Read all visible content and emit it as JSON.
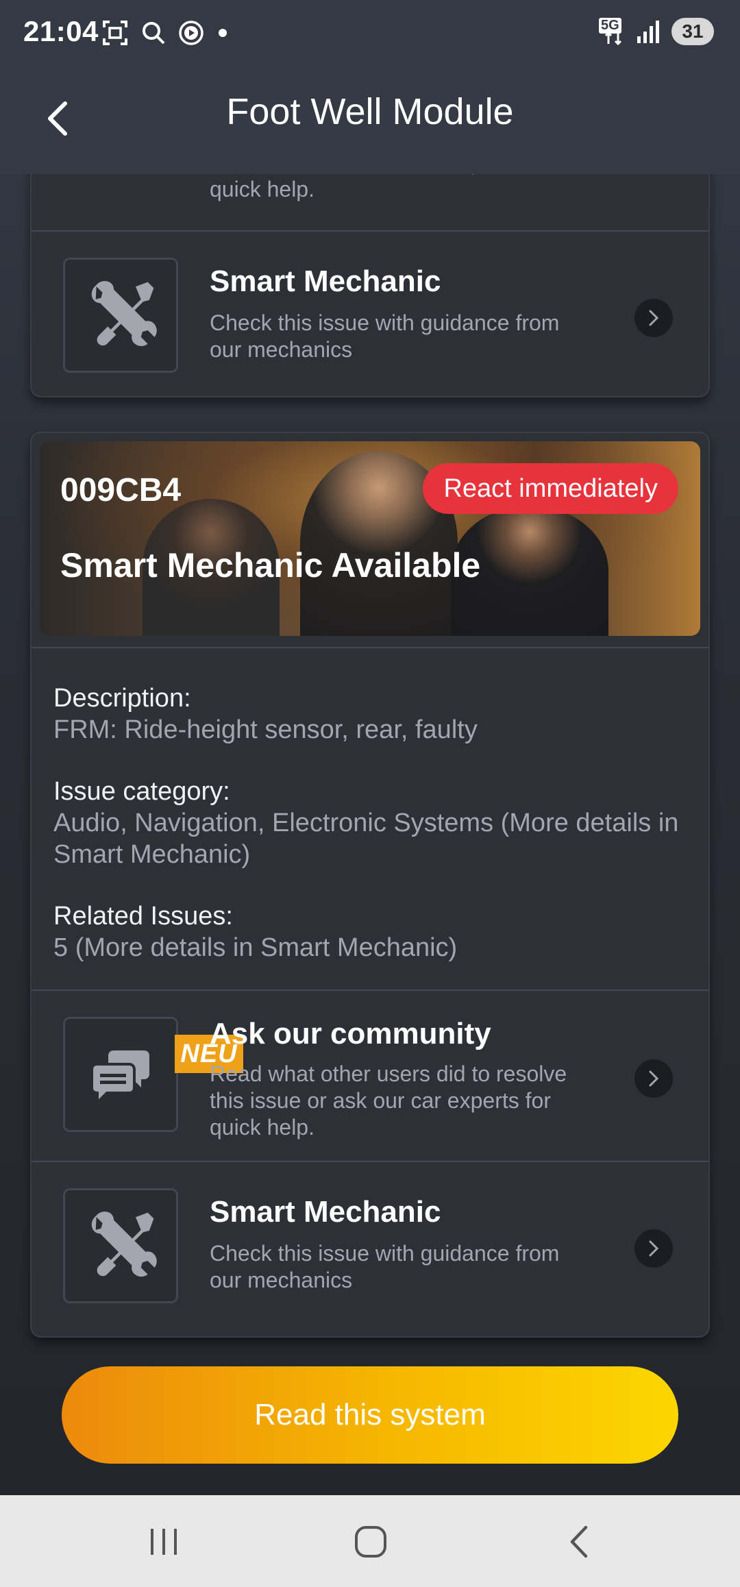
{
  "status_bar": {
    "time": "21:04",
    "network": "5G",
    "battery": "31"
  },
  "header": {
    "title": "Foot Well Module"
  },
  "top_card": {
    "partial_text": "this issue or ask our car experts for quick help.",
    "smart_mechanic": {
      "title": "Smart Mechanic",
      "subtitle": "Check this issue with guidance from our mechanics"
    }
  },
  "issue_card": {
    "code": "009CB4",
    "title": "Smart Mechanic Available",
    "badge": "React immediately",
    "details": [
      {
        "label": "Description:",
        "value": "FRM: Ride-height sensor, rear, faulty"
      },
      {
        "label": "Issue category:",
        "value": "Audio, Navigation, Electronic Systems (More details in Smart Mechanic)"
      },
      {
        "label": "Related Issues:",
        "value": "5 (More details in Smart Mechanic)"
      }
    ],
    "community": {
      "badge": "NEU",
      "title": "Ask our community",
      "subtitle": "Read what other users did to resolve this issue or ask our car experts for quick help."
    },
    "smart_mechanic": {
      "title": "Smart Mechanic",
      "subtitle": "Check this issue with guidance from our mechanics"
    }
  },
  "cta": {
    "label": "Read this system"
  },
  "colors": {
    "accent_orange": "#ec8a0c",
    "accent_yellow": "#fcd600",
    "urgent_red": "#e8333d",
    "badge_orange": "#f0a11a"
  },
  "icons": {
    "back": "chevron-left-icon",
    "tools": "wrench-screwdriver-icon",
    "chat": "chat-bubbles-icon",
    "chevron": "chevron-right-icon"
  }
}
